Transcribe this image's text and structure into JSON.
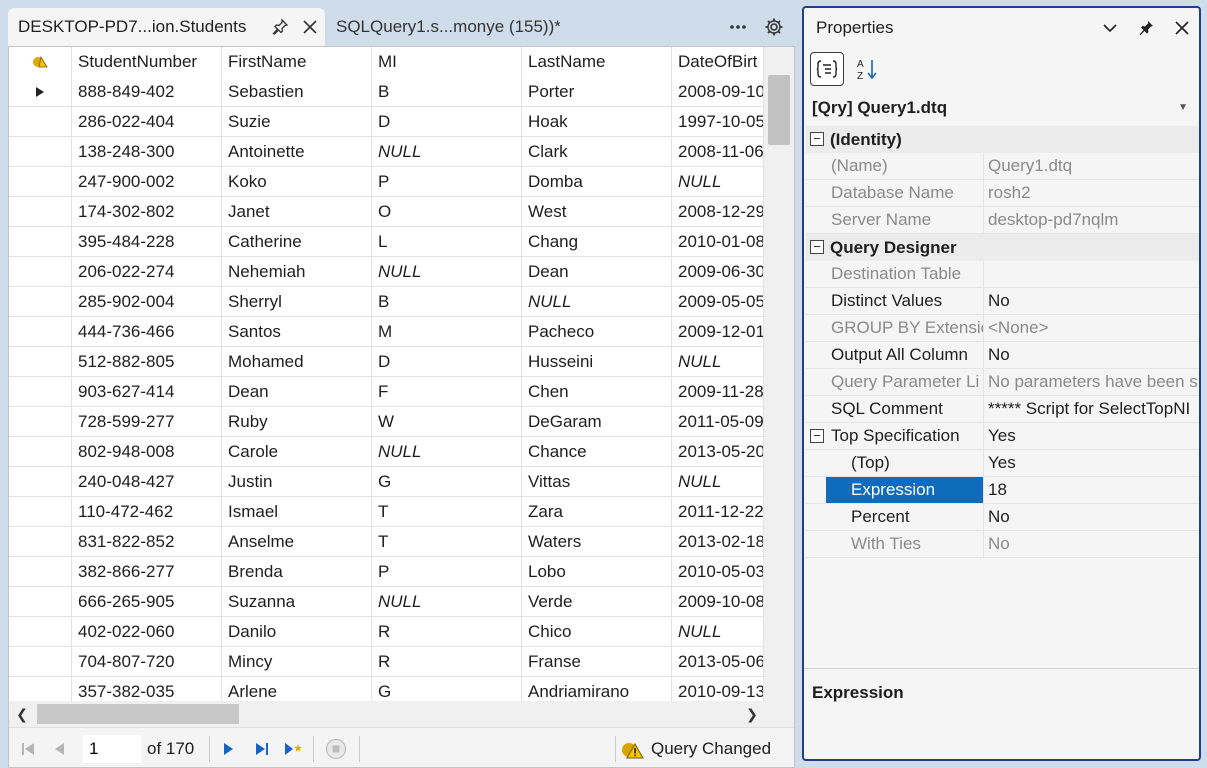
{
  "tabs": [
    {
      "title": "DESKTOP-PD7...ion.Students",
      "active": true
    },
    {
      "title": "SQLQuery1.s...monye (155))*",
      "active": false
    }
  ],
  "grid": {
    "columns": [
      "StudentNumber",
      "FirstName",
      "MI",
      "LastName",
      "DateOfBirt"
    ],
    "rows": [
      [
        "888-849-402",
        "Sebastien",
        "B",
        "Porter",
        "2008-09-10"
      ],
      [
        "286-022-404",
        "Suzie",
        "D",
        "Hoak",
        "1997-10-05"
      ],
      [
        "138-248-300",
        "Antoinette",
        "NULL",
        "Clark",
        "2008-11-06"
      ],
      [
        "247-900-002",
        "Koko",
        "P",
        "Domba",
        "NULL"
      ],
      [
        "174-302-802",
        "Janet",
        "O",
        "West",
        "2008-12-29"
      ],
      [
        "395-484-228",
        "Catherine",
        "L",
        "Chang",
        "2010-01-08"
      ],
      [
        "206-022-274",
        "Nehemiah",
        "NULL",
        "Dean",
        "2009-06-30"
      ],
      [
        "285-902-004",
        "Sherryl",
        "B",
        "NULL",
        "2009-05-05"
      ],
      [
        "444-736-466",
        "Santos",
        "M",
        "Pacheco",
        "2009-12-01"
      ],
      [
        "512-882-805",
        "Mohamed",
        "D",
        "Husseini",
        "NULL"
      ],
      [
        "903-627-414",
        "Dean",
        "F",
        "Chen",
        "2009-11-28"
      ],
      [
        "728-599-277",
        "Ruby",
        "W",
        "DeGaram",
        "2011-05-09"
      ],
      [
        "802-948-008",
        "Carole",
        "NULL",
        "Chance",
        "2013-05-20"
      ],
      [
        "240-048-427",
        "Justin",
        "G",
        "Vittas",
        "NULL"
      ],
      [
        "110-472-462",
        "Ismael",
        "T",
        "Zara",
        "2011-12-22"
      ],
      [
        "831-822-852",
        "Anselme",
        "T",
        "Waters",
        "2013-02-18"
      ],
      [
        "382-866-277",
        "Brenda",
        "P",
        "Lobo",
        "2010-05-03"
      ],
      [
        "666-265-905",
        "Suzanna",
        "NULL",
        "Verde",
        "2009-10-08"
      ],
      [
        "402-022-060",
        "Danilo",
        "R",
        "Chico",
        "NULL"
      ],
      [
        "704-807-720",
        "Mincy",
        "R",
        "Franse",
        "2013-05-06"
      ],
      [
        "357-382-035",
        "Arlene",
        "G",
        "Andriamirano",
        "2010-09-13"
      ]
    ]
  },
  "navigation": {
    "current_page": "1",
    "total_label": "of 170",
    "status_text": "Query Changed"
  },
  "properties": {
    "title": "Properties",
    "object": "[Qry] Query1.dtq",
    "categories": [
      {
        "name": "(Identity)",
        "toggle": "⊟",
        "items": [
          {
            "name": "(Name)",
            "value": "Query1.dtq",
            "readonly": true
          },
          {
            "name": "Database Name",
            "value": "rosh2",
            "readonly": true
          },
          {
            "name": "Server Name",
            "value": "desktop-pd7nqlm",
            "readonly": true
          }
        ]
      },
      {
        "name": "Query Designer",
        "toggle": "⊟",
        "items": [
          {
            "name": "Destination Table",
            "value": "",
            "readonly": true
          },
          {
            "name": "Distinct Values",
            "value": "No",
            "readonly": false
          },
          {
            "name": "GROUP BY Extensic",
            "value": "<None>",
            "readonly": true
          },
          {
            "name": "Output All Column",
            "value": "No",
            "readonly": false
          },
          {
            "name": "Query Parameter Li",
            "value": "No parameters have been s",
            "readonly": true
          },
          {
            "name": "SQL Comment",
            "value": "***** Script for SelectTopNI",
            "readonly": false
          },
          {
            "name": "Top Specification",
            "value": "Yes",
            "readonly": false,
            "expander": "⊟"
          },
          {
            "name": "(Top)",
            "value": "Yes",
            "readonly": false,
            "indent": true
          },
          {
            "name": "Expression",
            "value": "18",
            "readonly": false,
            "indent": true,
            "selected": true
          },
          {
            "name": "Percent",
            "value": "No",
            "readonly": false,
            "indent": true
          },
          {
            "name": "With Ties",
            "value": "No",
            "readonly": true,
            "indent": true
          }
        ]
      }
    ],
    "description_title": "Expression"
  },
  "icons": {
    "pin": "pin-icon",
    "close": "close-icon",
    "more": "more-icon",
    "settings": "gear-icon",
    "categorized": "categorized-icon",
    "alphabetical": "alphabetical-sort-icon"
  },
  "colors": {
    "selection": "#0f6cbd",
    "frame_accent": "#1f3f8a",
    "nav_blue": "#1565c0"
  }
}
